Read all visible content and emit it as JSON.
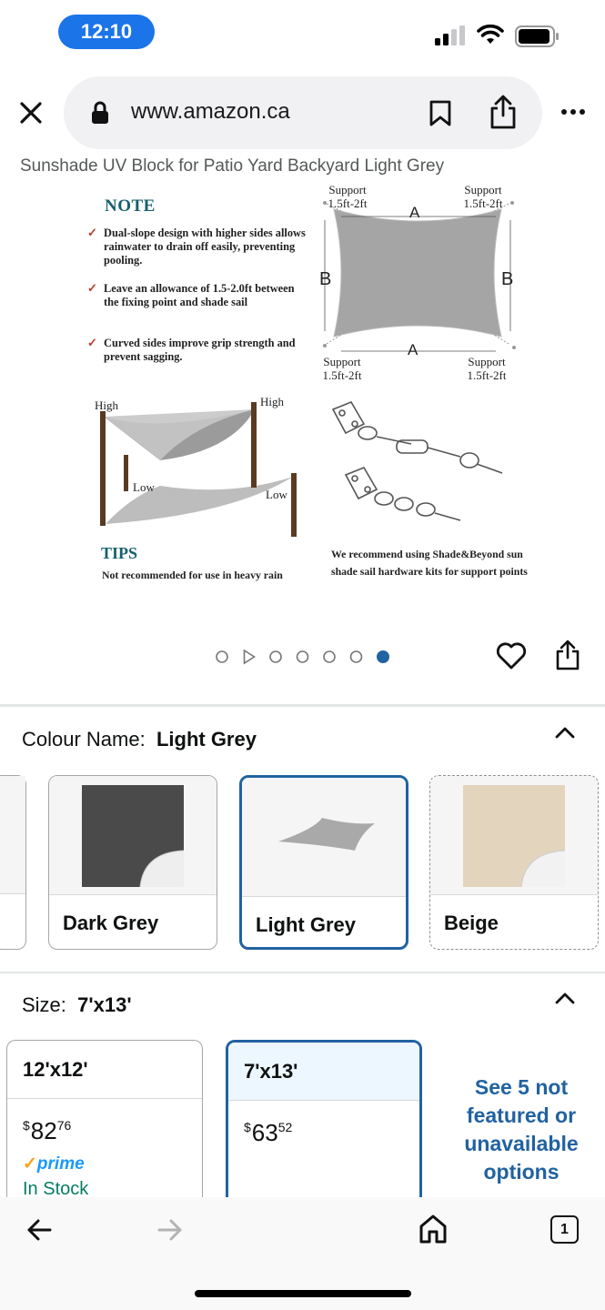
{
  "status_bar": {
    "time": "12:10"
  },
  "browser": {
    "url": "www.amazon.ca",
    "page_title": "Sunshade UV Block for Patio Yard Backyard Light Grey"
  },
  "infographic": {
    "note_title": "NOTE",
    "notes": [
      "Dual-slope design with higher sides allows rainwater to drain off easily, preventing pooling.",
      "Leave an allowance of 1.5-2.0ft between the fixing point and shade sail",
      "Curved sides improve grip strength and prevent sagging."
    ],
    "support_label": "Support",
    "support_range": "1.5ft-2ft",
    "dim_a": "A",
    "dim_b": "B",
    "high_label": "High",
    "low_label": "Low",
    "tips_title": "TIPS",
    "tips_text": "Not recommended for use in heavy rain",
    "recommend_text": "We recommend using Shade&Beyond sun shade sail hardware kits for support points"
  },
  "carousel": {
    "total": 7,
    "active_index": 6
  },
  "colour": {
    "label": "Colour Name:",
    "selected": "Light Grey",
    "options": [
      {
        "name": "Dark Grey",
        "color": "#4a4a4a"
      },
      {
        "name": "Light Grey",
        "color": "#a9a9a9"
      },
      {
        "name": "Beige",
        "color": "#e3d5bd"
      }
    ]
  },
  "size": {
    "label": "Size:",
    "selected": "7'x13'",
    "options": [
      {
        "name": "12'x12'",
        "currency": "$",
        "price_whole": "82",
        "price_fraction": "76",
        "prime": "prime",
        "availability": "In Stock"
      },
      {
        "name": "7'x13'",
        "currency": "$",
        "price_whole": "63",
        "price_fraction": "52"
      }
    ],
    "see_more": "See 5 not featured or unavailable options"
  },
  "toolbar": {
    "tab_count": "1"
  },
  "colors": {
    "accent": "#2162a1",
    "status_pill": "#1c74e9",
    "stock_green": "#067d62",
    "prime_blue": "#1a98ff"
  }
}
